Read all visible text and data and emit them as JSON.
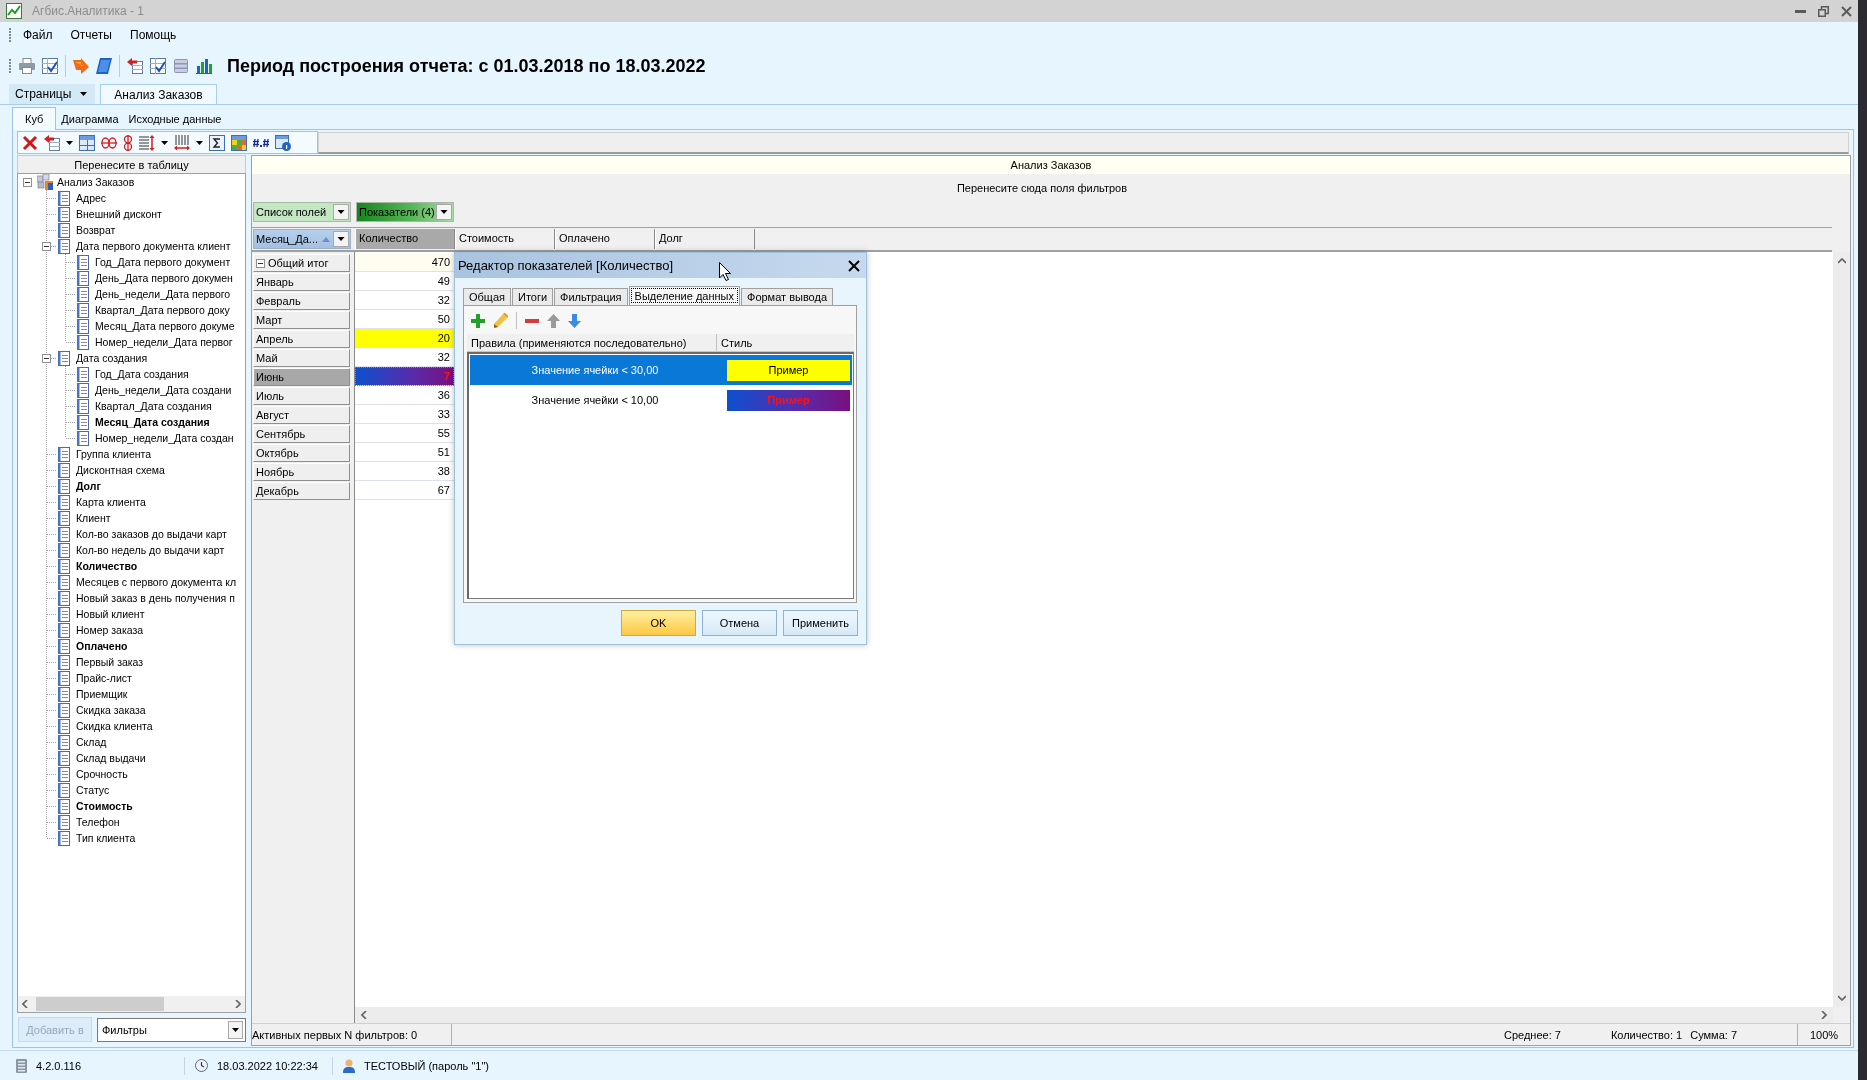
{
  "window": {
    "title": "Агбис.Аналитика - 1"
  },
  "menu": [
    "Файл",
    "Отчеты",
    "Помощь"
  ],
  "toolbar": {
    "report_period": "Период построения отчета: с 01.03.2018 по 18.03.2022"
  },
  "pages_button": "Страницы",
  "page_tabs": [
    {
      "label": "Анализ Заказов",
      "selected": true
    }
  ],
  "view_tabs": [
    {
      "label": "Куб",
      "selected": true
    },
    {
      "label": "Диаграмма",
      "selected": false
    },
    {
      "label": "Исходные данные",
      "selected": false
    }
  ],
  "field_panel": {
    "header": "Перенесите в таблицу",
    "tree": [
      {
        "label": "Анализ Заказов",
        "kind": "cube",
        "used": false,
        "expanded": true,
        "children": [
          {
            "label": "Адрес",
            "kind": "field",
            "used": false
          },
          {
            "label": "Внешний дисконт",
            "kind": "field",
            "used": false
          },
          {
            "label": "Возврат",
            "kind": "field",
            "used": false
          },
          {
            "label": "Дата первого документа клиент",
            "kind": "field",
            "used": false,
            "expanded": true,
            "children": [
              {
                "label": "Год_Дата первого документ",
                "kind": "field",
                "used": false
              },
              {
                "label": "День_Дата первого докумен",
                "kind": "field",
                "used": false
              },
              {
                "label": "День_недели_Дата первого",
                "kind": "field",
                "used": false
              },
              {
                "label": "Квартал_Дата первого доку",
                "kind": "field",
                "used": false
              },
              {
                "label": "Месяц_Дата первого докуме",
                "kind": "field",
                "used": false
              },
              {
                "label": "Номер_недели_Дата первог",
                "kind": "field",
                "used": false
              }
            ]
          },
          {
            "label": "Дата создания",
            "kind": "field",
            "used": false,
            "expanded": true,
            "children": [
              {
                "label": "Год_Дата создания",
                "kind": "field",
                "used": false
              },
              {
                "label": "День_недели_Дата создани",
                "kind": "field",
                "used": false
              },
              {
                "label": "Квартал_Дата создания",
                "kind": "field",
                "used": false
              },
              {
                "label": "Месяц_Дата создания",
                "kind": "field",
                "used": true
              },
              {
                "label": "Номер_недели_Дата создан",
                "kind": "field",
                "used": false
              }
            ]
          },
          {
            "label": "Группа клиента",
            "kind": "field",
            "used": false
          },
          {
            "label": "Дисконтная схема",
            "kind": "field",
            "used": false
          },
          {
            "label": "Долг",
            "kind": "field",
            "used": true
          },
          {
            "label": "Карта клиента",
            "kind": "field",
            "used": false
          },
          {
            "label": "Клиент",
            "kind": "field",
            "used": false
          },
          {
            "label": "Кол-во заказов до выдачи карт",
            "kind": "field",
            "used": false
          },
          {
            "label": "Кол-во недель до выдачи карт",
            "kind": "field",
            "used": false
          },
          {
            "label": "Количество",
            "kind": "field",
            "used": true
          },
          {
            "label": "Месяцев с первого документа кл",
            "kind": "field",
            "used": false
          },
          {
            "label": "Новый заказ в день получения п",
            "kind": "field",
            "used": false
          },
          {
            "label": "Новый клиент",
            "kind": "field",
            "used": false
          },
          {
            "label": "Номер заказа",
            "kind": "field",
            "used": false
          },
          {
            "label": "Оплачено",
            "kind": "field",
            "used": true
          },
          {
            "label": "Первый заказ",
            "kind": "field",
            "used": false
          },
          {
            "label": "Прайс-лист",
            "kind": "field",
            "used": false
          },
          {
            "label": "Приемщик",
            "kind": "field",
            "used": false
          },
          {
            "label": "Скидка заказа",
            "kind": "field",
            "used": false
          },
          {
            "label": "Скидка клиента",
            "kind": "field",
            "used": false
          },
          {
            "label": "Склад",
            "kind": "field",
            "used": false
          },
          {
            "label": "Склад выдачи",
            "kind": "field",
            "used": false
          },
          {
            "label": "Срочность",
            "kind": "field",
            "used": false
          },
          {
            "label": "Статус",
            "kind": "field",
            "used": false
          },
          {
            "label": "Стоимость",
            "kind": "field",
            "used": true
          },
          {
            "label": "Телефон",
            "kind": "field",
            "used": false
          },
          {
            "label": "Тип клиента",
            "kind": "field",
            "used": false
          }
        ]
      }
    ],
    "add_button": {
      "label": "Добавить в",
      "disabled": true
    },
    "target_select": {
      "value": "Фильтры"
    }
  },
  "pivot": {
    "title": "Анализ Заказов",
    "filter_hint": "Перенесите сюда поля фильтров",
    "field_list_button": "Список полей",
    "measures_button": "Показатели (4)",
    "row_field": {
      "label": "Месяц_Да...",
      "sorted": true
    },
    "columns": [
      {
        "label": "Количество",
        "selected": true
      },
      {
        "label": "Стоимость",
        "selected": false
      },
      {
        "label": "Оплачено",
        "selected": false
      },
      {
        "label": "Долг",
        "selected": false
      }
    ],
    "total": {
      "label": "Общий итог",
      "expanded": true,
      "value": "470"
    },
    "rows": [
      {
        "label": "Январь",
        "value": "49",
        "selected": false,
        "kind": "plain"
      },
      {
        "label": "Февраль",
        "value": "32",
        "selected": false,
        "kind": "plain"
      },
      {
        "label": "Март",
        "value": "50",
        "selected": false,
        "kind": "plain"
      },
      {
        "label": "Апрель",
        "value": "20",
        "selected": false,
        "kind": "marked"
      },
      {
        "label": "Май",
        "value": "32",
        "selected": false,
        "kind": "plain"
      },
      {
        "label": "Июнь",
        "value": "7",
        "selected": true,
        "kind": "alert"
      },
      {
        "label": "Июль",
        "value": "36",
        "selected": false,
        "kind": "plain"
      },
      {
        "label": "Август",
        "value": "33",
        "selected": false,
        "kind": "plain"
      },
      {
        "label": "Сентябрь",
        "value": "55",
        "selected": false,
        "kind": "plain"
      },
      {
        "label": "Октябрь",
        "value": "51",
        "selected": false,
        "kind": "plain"
      },
      {
        "label": "Ноябрь",
        "value": "38",
        "selected": false,
        "kind": "plain"
      },
      {
        "label": "Декабрь",
        "value": "67",
        "selected": false,
        "kind": "plain"
      }
    ],
    "status": {
      "filters": "Активных первых N фильтров: 0",
      "average": "Среднее: 7",
      "count": "Количество: 1",
      "sum": "Сумма: 7",
      "zoom": "100%"
    }
  },
  "dialog": {
    "title": "Редактор показателей [Количество]",
    "tabs": [
      {
        "label": "Общая",
        "selected": false
      },
      {
        "label": "Итоги",
        "selected": false
      },
      {
        "label": "Фильтрация",
        "selected": false
      },
      {
        "label": "Выделение данных",
        "selected": true
      },
      {
        "label": "Формат вывода",
        "selected": false
      }
    ],
    "columns": [
      "Правила (применяются последовательно)",
      "Стиль"
    ],
    "rules": [
      {
        "condition": "Значение ячейки < 30,00",
        "sample": "Пример",
        "kind": "marked",
        "selected": true
      },
      {
        "condition": "Значение ячейки < 10,00",
        "sample": "Пример",
        "kind": "alert",
        "selected": false
      }
    ],
    "buttons": [
      {
        "label": "OK",
        "kind": "default"
      },
      {
        "label": "Отмена",
        "kind": "normal"
      },
      {
        "label": "Применить",
        "kind": "normal"
      }
    ]
  },
  "status_bar": {
    "version": "4.2.0.116",
    "datetime": "18.03.2022 10:22:34",
    "user": "ТЕСТОВЫЙ (пароль \"1\")"
  }
}
